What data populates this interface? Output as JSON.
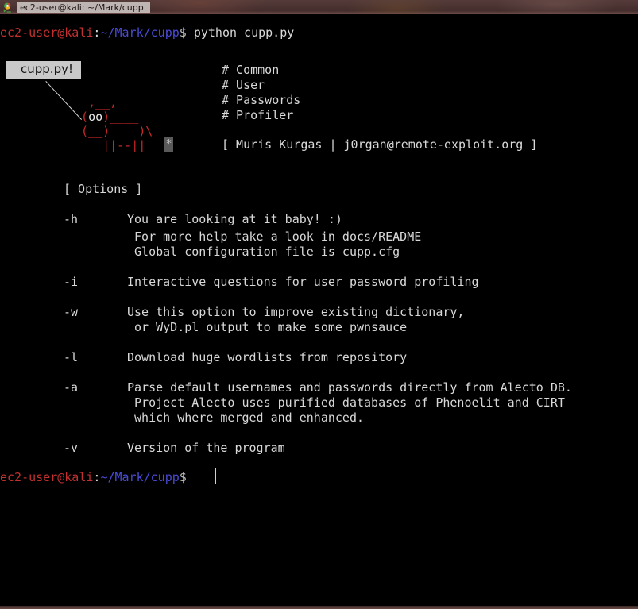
{
  "window": {
    "title": "ec2-user@kali: ~/Mark/cupp",
    "icon": "terminal-app-icon",
    "background_color": "#000000",
    "titlebar_color": "#4a3331"
  },
  "terminal": {
    "prompt": {
      "user_host": "ec2-user@kali",
      "separator": ":",
      "path": "~/Mark/cupp",
      "sigil": "$",
      "colors": {
        "user_host": "#c33030",
        "path": "#4a4ad8",
        "sigil": "#b9b9b9",
        "text": "#d8d8d8"
      }
    },
    "command": "python cupp.py",
    "banner": {
      "callout_label": "cupp.py!",
      "art_lines": [
        "  ,__,",
        " (oo)____",
        " (__)    )\\",
        "    ||--||",
        ""
      ],
      "art_color": "#c62828",
      "eye_text": "oo",
      "asterisk": "*",
      "acronym": [
        "# Common",
        "# User",
        "# Passwords",
        "# Profiler"
      ],
      "author_line": "[ Muris Kurgas | j0rgan@remote-exploit.org ]"
    },
    "options_header": "[ Options ]",
    "options": [
      {
        "flag": "-h",
        "lines": [
          "You are looking at it baby! :)",
          " For more help take a look in docs/README",
          " Global configuration file is cupp.cfg"
        ]
      },
      {
        "flag": "-i",
        "lines": [
          "Interactive questions for user password profiling"
        ]
      },
      {
        "flag": "-w",
        "lines": [
          "Use this option to improve existing dictionary,",
          " or WyD.pl output to make some pwnsauce"
        ]
      },
      {
        "flag": "-l",
        "lines": [
          "Download huge wordlists from repository"
        ]
      },
      {
        "flag": "-a",
        "lines": [
          "Parse default usernames and passwords directly from Alecto DB.",
          " Project Alecto uses purified databases of Phenoelit and CIRT",
          " which where merged and enhanced."
        ]
      },
      {
        "flag": "-v",
        "lines": [
          "Version of the program"
        ]
      }
    ]
  }
}
